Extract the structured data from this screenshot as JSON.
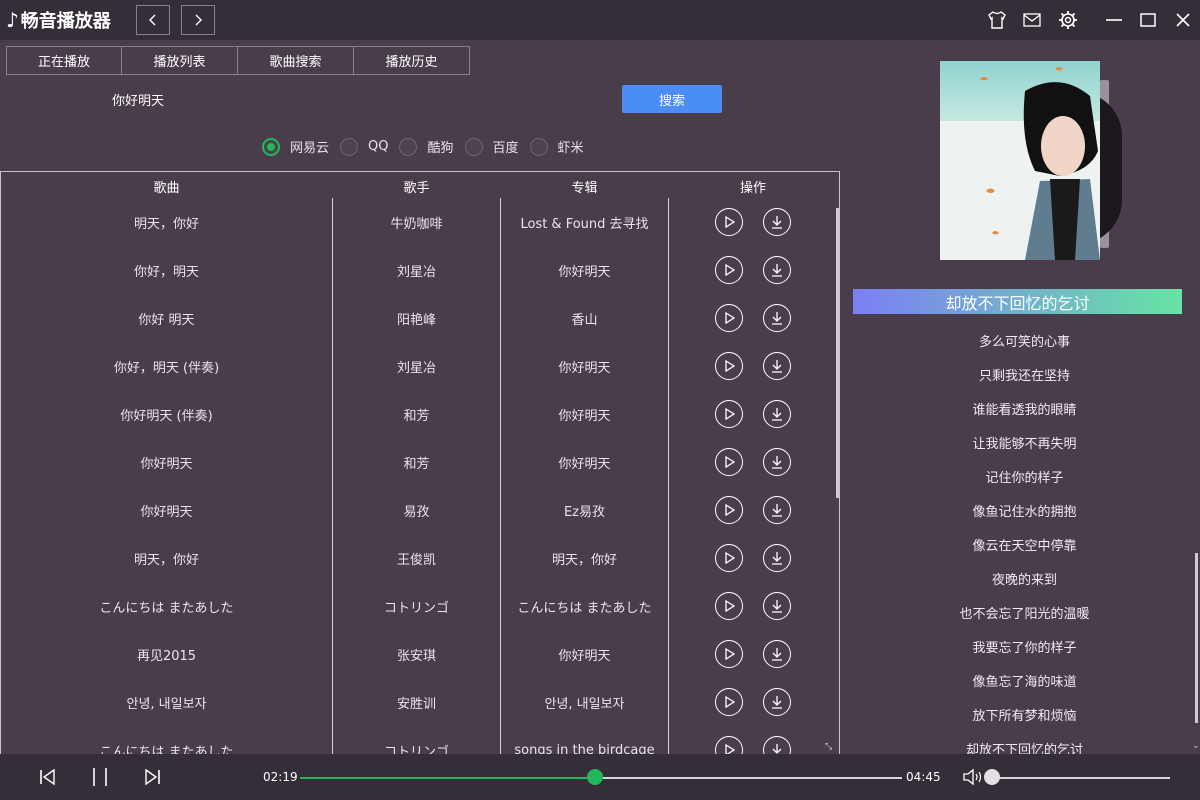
{
  "app": {
    "title": "畅音播放器"
  },
  "tabs": [
    {
      "label": "正在播放"
    },
    {
      "label": "播放列表"
    },
    {
      "label": "歌曲搜索"
    },
    {
      "label": "播放历史"
    }
  ],
  "search": {
    "value": "你好明天",
    "button_label": "搜索"
  },
  "sources": [
    {
      "label": "网易云",
      "selected": true
    },
    {
      "label": "QQ",
      "selected": false
    },
    {
      "label": "酷狗",
      "selected": false
    },
    {
      "label": "百度",
      "selected": false
    },
    {
      "label": "虾米",
      "selected": false
    }
  ],
  "table": {
    "headers": [
      "歌曲",
      "歌手",
      "专辑",
      "操作"
    ],
    "rows": [
      {
        "song": "明天，你好",
        "artist": "牛奶咖啡",
        "album": "Lost & Found 去寻找"
      },
      {
        "song": "你好，明天",
        "artist": "刘星冶",
        "album": "你好明天"
      },
      {
        "song": "你好 明天",
        "artist": "阳艳峰",
        "album": "香山"
      },
      {
        "song": "你好，明天 (伴奏)",
        "artist": "刘星冶",
        "album": "你好明天"
      },
      {
        "song": "你好明天 (伴奏)",
        "artist": "和芳",
        "album": "你好明天"
      },
      {
        "song": "你好明天",
        "artist": "和芳",
        "album": "你好明天"
      },
      {
        "song": "你好明天",
        "artist": "易孜",
        "album": "Ez易孜"
      },
      {
        "song": "明天，你好",
        "artist": "王俊凯",
        "album": "明天，你好"
      },
      {
        "song": "こんにちは またあした",
        "artist": "コトリンゴ",
        "album": "こんにちは またあした"
      },
      {
        "song": "再见2015",
        "artist": "张安琪",
        "album": "你好明天"
      },
      {
        "song": "안녕, 내일보자",
        "artist": "安胜训",
        "album": "안녕, 내일보자"
      },
      {
        "song": "こんにちは またあした",
        "artist": "コトリンゴ",
        "album": "songs in the birdcage"
      }
    ]
  },
  "lyrics": {
    "current": "却放不下回忆的乞讨",
    "lines": [
      "多么可笑的心事",
      "只剩我还在坚持",
      "谁能看透我的眼睛",
      "让我能够不再失明",
      "记住你的样子",
      "像鱼记住水的拥抱",
      "像云在天空中停靠",
      "夜晚的来到",
      "也不会忘了阳光的温暖",
      "我要忘了你的样子",
      "像鱼忘了海的味道",
      "放下所有梦和烦恼",
      "却放不下回忆的乞讨"
    ]
  },
  "player": {
    "elapsed": "02:19",
    "duration": "04:45",
    "progress": 0.49,
    "volume": 0.0
  },
  "colors": {
    "background": "#4a3d4b",
    "titlebar": "#352d37",
    "accent_green": "#1fb85a",
    "search_button": "#4a8ef5"
  }
}
